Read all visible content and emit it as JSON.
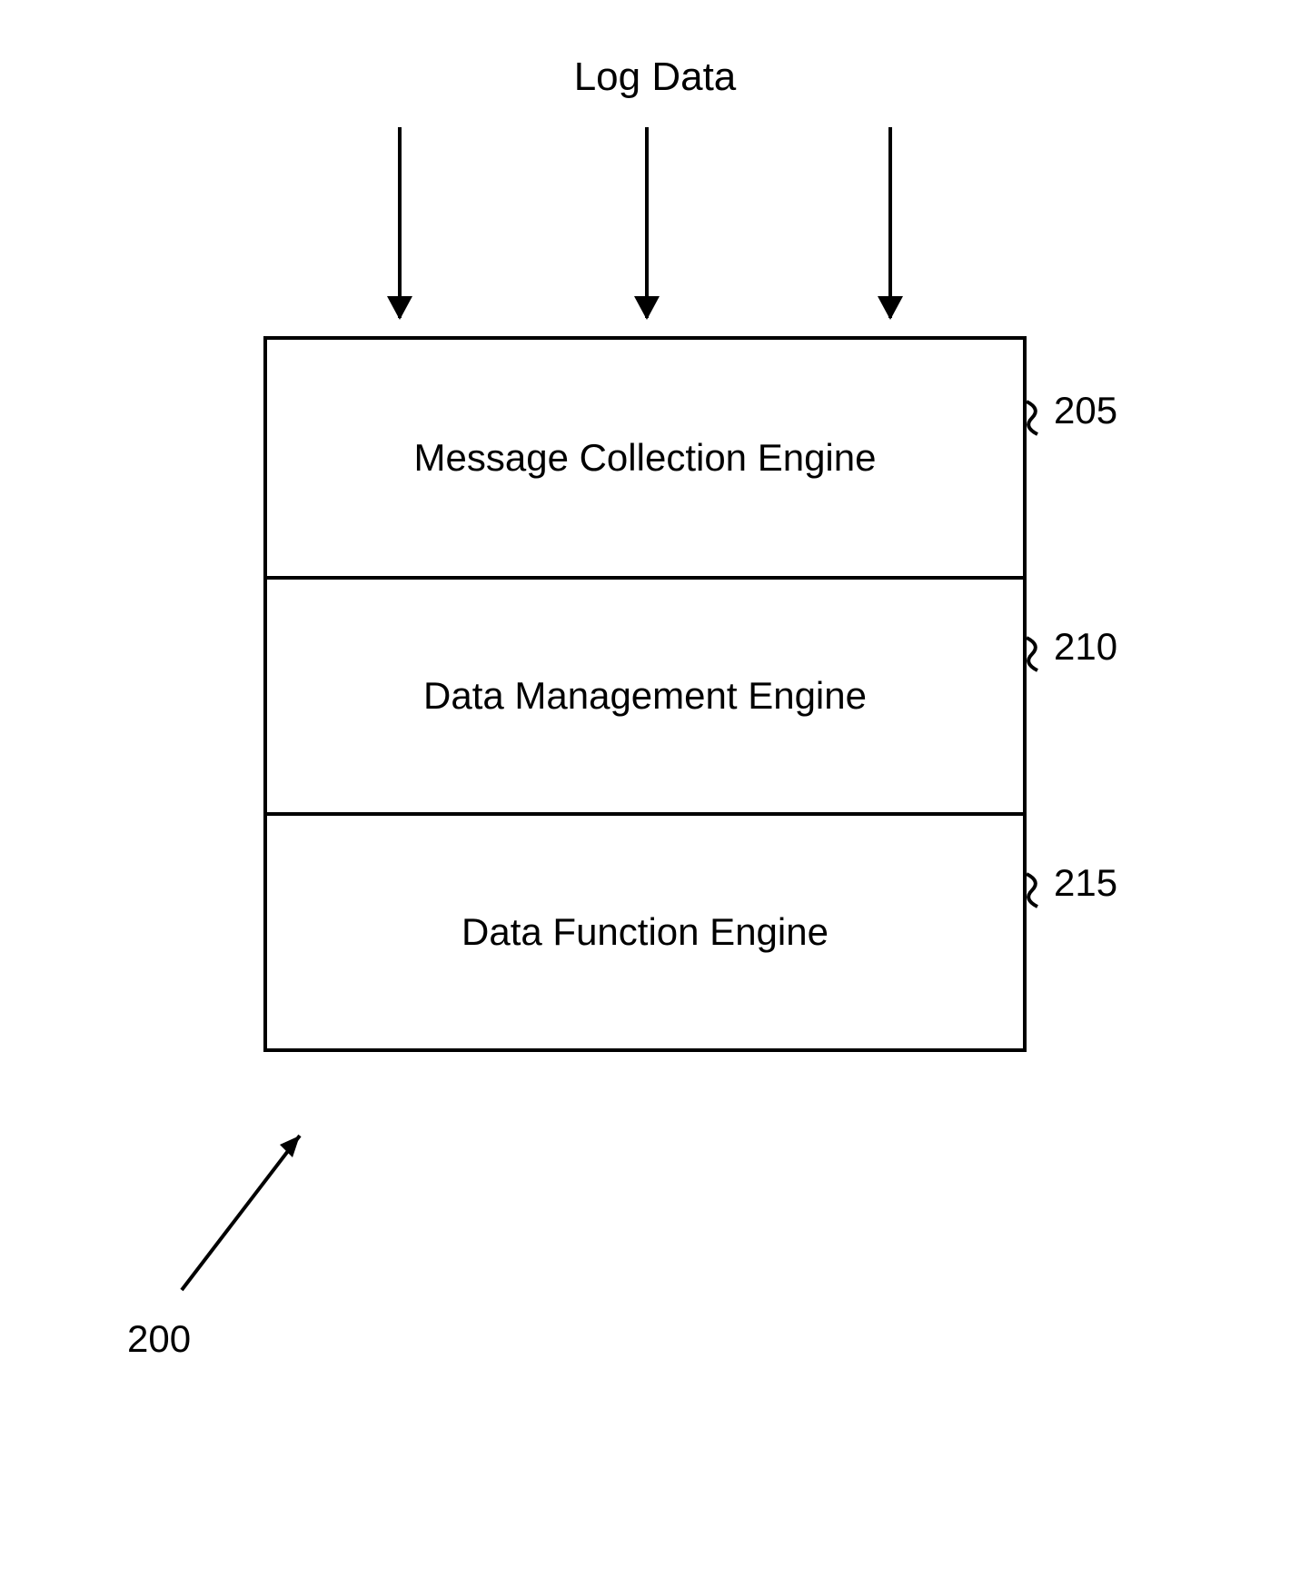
{
  "title": "Log Data",
  "layers": {
    "l0": {
      "label": "Message Collection  Engine",
      "ref": "205"
    },
    "l1": {
      "label": "Data Management Engine",
      "ref": "210"
    },
    "l2": {
      "label": "Data Function Engine",
      "ref": "215"
    }
  },
  "figure_ref": "200"
}
